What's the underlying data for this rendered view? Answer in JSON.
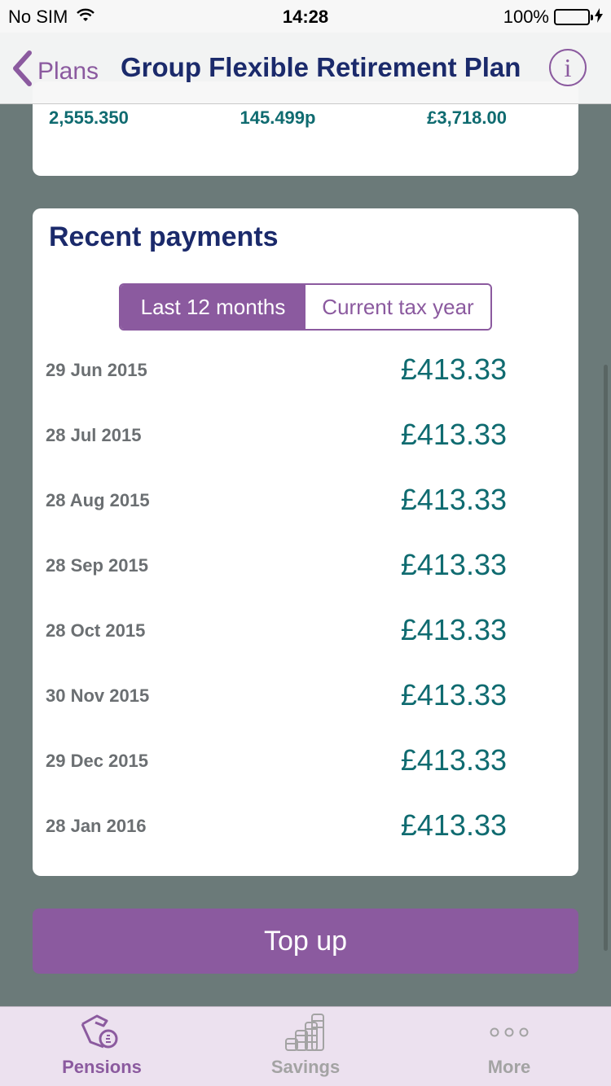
{
  "status_bar": {
    "carrier": "No SIM",
    "time": "14:28",
    "battery": "100%"
  },
  "nav": {
    "back_label": "Plans",
    "title": "Group Flexible Retirement Plan",
    "info_label": "i"
  },
  "summary": {
    "units": "2,555.350",
    "price": "145.499p",
    "value": "£3,718.00"
  },
  "payments": {
    "title": "Recent payments",
    "tabs": [
      {
        "label": "Last 12 months",
        "active": true
      },
      {
        "label": "Current tax year",
        "active": false
      }
    ],
    "rows": [
      {
        "date": "29 Jun 2015",
        "amount": "£413.33"
      },
      {
        "date": "28 Jul 2015",
        "amount": "£413.33"
      },
      {
        "date": "28 Aug 2015",
        "amount": "£413.33"
      },
      {
        "date": "28 Sep 2015",
        "amount": "£413.33"
      },
      {
        "date": "28 Oct 2015",
        "amount": "£413.33"
      },
      {
        "date": "30 Nov 2015",
        "amount": "£413.33"
      },
      {
        "date": "29 Dec 2015",
        "amount": "£413.33"
      },
      {
        "date": "28 Jan 2016",
        "amount": "£413.33"
      }
    ]
  },
  "top_up_label": "Top up",
  "tab_bar": {
    "tabs": [
      {
        "label": "Pensions",
        "icon": "pension-hand-icon",
        "active": true
      },
      {
        "label": "Savings",
        "icon": "coins-stack-icon",
        "active": false
      },
      {
        "label": "More",
        "icon": "more-dots-icon",
        "active": false
      }
    ]
  },
  "colors": {
    "accent": "#8b5a9f",
    "navy": "#1b2a6b",
    "teal": "#0f6b70",
    "background": "#6b7a79"
  }
}
